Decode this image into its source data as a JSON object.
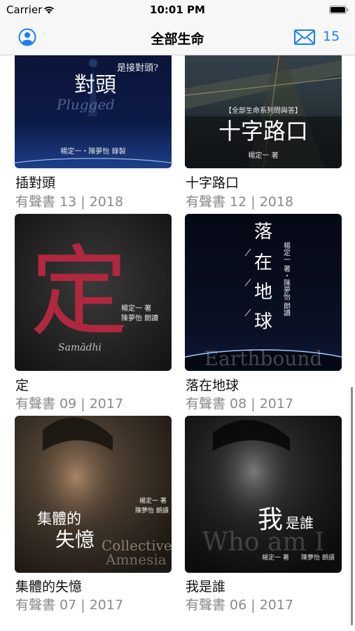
{
  "status_bar": {
    "carrier": "Carrier",
    "time": "10:01 PM"
  },
  "nav": {
    "title": "全部生命",
    "mail_count": "15",
    "accent_color": "#1e7ff3"
  },
  "books": [
    {
      "title": "插對頭",
      "subtitle": "有聲書 13 | 2018",
      "cover": {
        "title_chars": "對頭",
        "top_text": "是接對頭?",
        "english": "Plugged",
        "credit": "楊定一・陳夢怡 錄製"
      }
    },
    {
      "title": "十字路口",
      "subtitle": "有聲書 12 | 2018",
      "cover": {
        "series": "【全部生命系列問與答】",
        "title_chars": "十字路口",
        "credit": "楊定一 著"
      }
    },
    {
      "title": "定",
      "subtitle": "有聲書 09 | 2017",
      "cover": {
        "title_chars": "定",
        "english": "Samādhi",
        "credit_author": "楊定一 著",
        "credit_reader": "陳夢怡 朗讀"
      }
    },
    {
      "title": "落在地球",
      "subtitle": "有聲書 08 | 2017",
      "cover": {
        "c1": "落",
        "c2": "在",
        "c3": "地",
        "c4": "球",
        "credit": "楊定一 著・陳夢怡 朗讀",
        "english": "Earthbound"
      }
    },
    {
      "title": "集體的失憶",
      "subtitle": "有聲書 07 | 2017",
      "cover": {
        "line1": "集體的",
        "line2": "失憶",
        "english1": "Collective",
        "english2": "Amnesia",
        "credit_author": "楊定一 著",
        "credit_reader": "陳夢怡 朗讀"
      }
    },
    {
      "title": "我是誰",
      "subtitle": "有聲書 06 | 2017",
      "cover": {
        "big": "我",
        "small": "是誰",
        "english": "Who am I",
        "credit_author": "楊定一 著",
        "credit_reader": "陳夢怡 朗讀"
      }
    }
  ]
}
